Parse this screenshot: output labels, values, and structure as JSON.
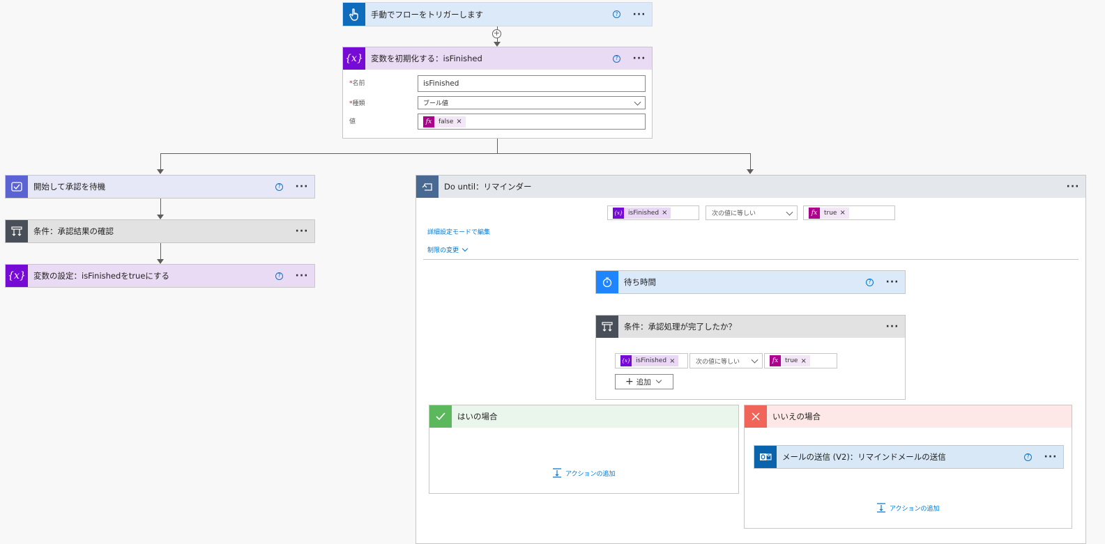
{
  "trigger": {
    "title": "手動でフローをトリガーします",
    "help": "?",
    "more": "···",
    "color": "#0f6cbd"
  },
  "init_var": {
    "title": "変数を初期化する：isFinished",
    "help": "?",
    "more": "···",
    "name_label": "名前",
    "name_value": "isFinished",
    "type_label": "種類",
    "type_value": "ブール値",
    "value_label": "値",
    "value_token": "false",
    "req_mark": "*",
    "fx": "fx",
    "x_mark": "×"
  },
  "approval": {
    "title": "開始して承認を待機",
    "help": "?",
    "more": "···"
  },
  "condition_result": {
    "title": "条件：承認結果の確認",
    "more": "···"
  },
  "set_var": {
    "title": "変数の設定：isFinishedをtrueにする",
    "help": "?",
    "more": "···"
  },
  "do_until": {
    "title": "Do until：リマインダー",
    "more": "···",
    "cond_left": "isFinished",
    "cond_op": "次の値に等しい",
    "cond_right": "true",
    "advanced_link": "詳細設定モードで編集",
    "limits_link": "制限の変更",
    "x_mark": "×",
    "fx": "fx"
  },
  "wait": {
    "title": "待ち時間",
    "help": "?",
    "more": "···"
  },
  "condition_done": {
    "title": "条件：承認処理が完了したか？",
    "more": "···",
    "left": "isFinished",
    "op": "次の値に等しい",
    "right": "true",
    "add_label": "追加",
    "x_mark": "×",
    "fx": "fx"
  },
  "yes_branch": {
    "title": "はいの場合",
    "add_action": "アクションの追加"
  },
  "no_branch": {
    "title": "いいえの場合",
    "add_action": "アクションの追加"
  },
  "send_mail": {
    "title": "メールの送信 (V2)：リマインドメールの送信",
    "help": "?",
    "more": "···"
  },
  "icons": {
    "trigger": "hand-touch-icon",
    "variable": "variable-braces-icon",
    "approval": "approval-icon",
    "condition": "condition-icon",
    "do_until": "loop-icon",
    "wait": "timer-icon",
    "yes": "check-icon",
    "no": "close-icon",
    "outlook": "outlook-icon"
  },
  "colors": {
    "trigger": "#0f6cbd",
    "variable": "#770bd6",
    "variable_bg": "#eadbf5",
    "approval": "#4b53bc",
    "approval_bg": "#e6e7f7",
    "condition": "#484f58",
    "condition_bg": "#e2e2e2",
    "loop": "#486991",
    "loop_bg": "#e4e7ec",
    "yes": "#5cb85c",
    "yes_bg": "#eaf6ec",
    "no": "#f0645a",
    "no_bg": "#fde7e7",
    "fx": "#ad008c"
  }
}
